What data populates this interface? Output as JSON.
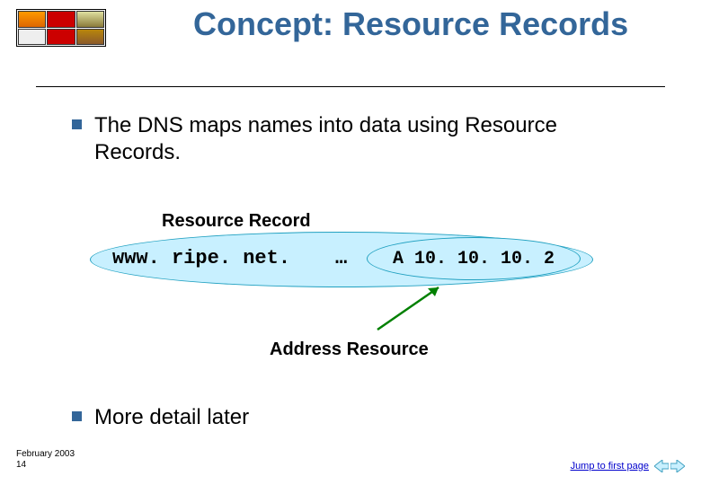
{
  "title": "Concept: Resource Records",
  "bullets": [
    "The DNS maps names into data using Resource Records.",
    "More detail later"
  ],
  "diagram": {
    "outer_label": "Resource Record",
    "domain_text": "www. ripe. net.",
    "ellipsis": "…",
    "inner_text": "A 10. 10. 10. 2",
    "pointer_label": "Address Resource"
  },
  "footer": {
    "date": "February 2003",
    "page_num": "14",
    "jump_label": "Jump to first page"
  },
  "colors": {
    "heading": "#336699",
    "ellipse_fill": "#c8f0ff",
    "ellipse_stroke": "#20a0c0",
    "arrow": "#008000"
  }
}
